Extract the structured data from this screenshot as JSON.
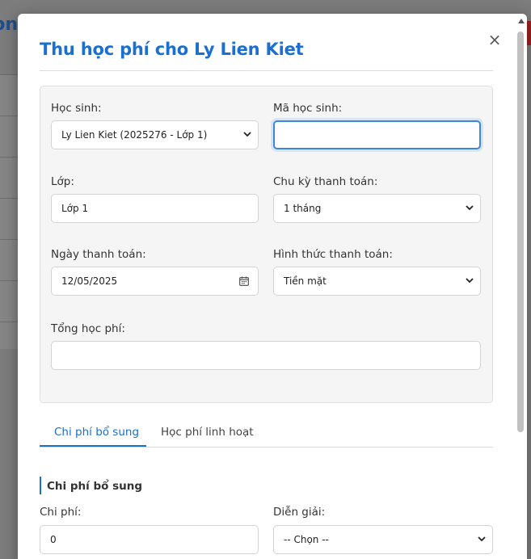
{
  "background": {
    "title_fragment": "ion"
  },
  "modal": {
    "title": "Thu học phí cho Ly Lien Kiet",
    "close_symbol": "×"
  },
  "form": {
    "student_label": "Học sinh:",
    "student_value": "Ly Lien Kiet (2025276 - Lớp 1)",
    "student_code_label": "Mã học sinh:",
    "student_code_value": "",
    "class_label": "Lớp:",
    "class_value": "Lớp 1",
    "cycle_label": "Chu kỳ thanh toán:",
    "cycle_value": "1 tháng",
    "date_label": "Ngày thanh toán:",
    "date_value": "12/05/2025",
    "method_label": "Hình thức thanh toán:",
    "method_value": "Tiền mặt",
    "total_label": "Tổng học phí:",
    "total_value": ""
  },
  "tabs": [
    {
      "label": "Chi phí bổ sung",
      "active": true
    },
    {
      "label": "Học phí linh hoạt",
      "active": false
    }
  ],
  "extra": {
    "section_title": "Chi phí bổ sung",
    "cost_label": "Chi phí:",
    "cost_value": "0",
    "desc_label": "Diễn giải:",
    "desc_value": "-- Chọn --"
  },
  "colors": {
    "accent": "#1a6fd0",
    "focus_border": "#3a86e0"
  },
  "icons": {
    "close": "close-icon",
    "select_arrow": "chevron-down-icon",
    "calendar": "calendar-icon"
  }
}
